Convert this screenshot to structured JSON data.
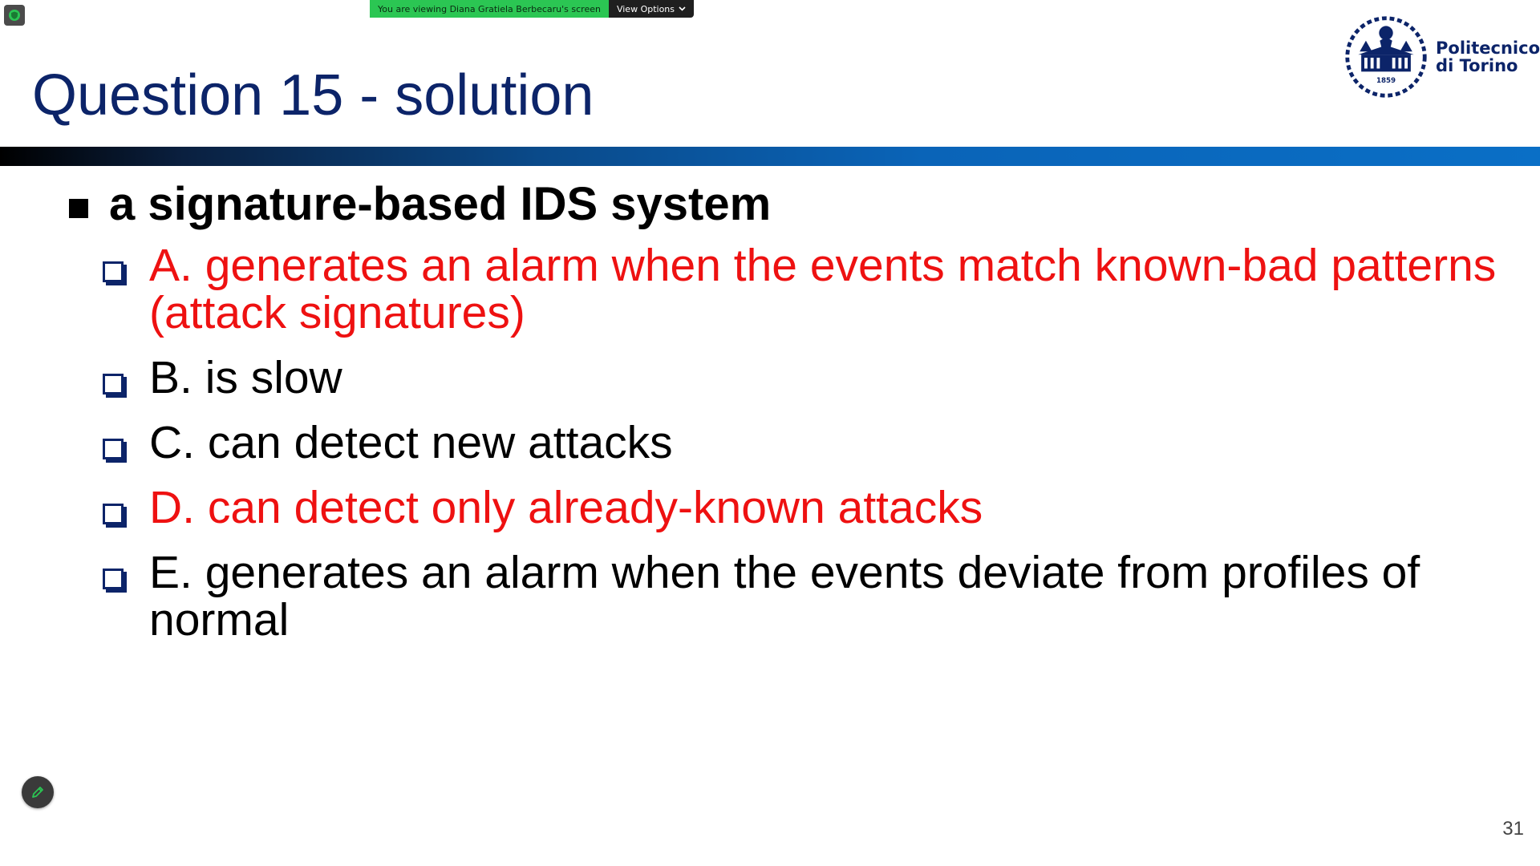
{
  "zoom": {
    "viewing_banner": "You are viewing Diana Gratiela Berbecaru's screen",
    "view_options_label": "View Options"
  },
  "slide": {
    "title": "Question 15 - solution",
    "question": "a signature-based IDS system",
    "options": [
      {
        "text": "A. generates an alarm when the events match known-bad patterns (attack signatures)",
        "correct": true
      },
      {
        "text": "B. is slow",
        "correct": false
      },
      {
        "text": "C. can detect new attacks",
        "correct": false
      },
      {
        "text": "D. can detect only already-known attacks",
        "correct": true
      },
      {
        "text": "E. generates an alarm when the events deviate from profiles of normal",
        "correct": false
      }
    ],
    "page_number": "31"
  },
  "logo": {
    "line1": "Politecnico",
    "line2": "di Torino",
    "year": "1859"
  },
  "colors": {
    "title": "#0c2469",
    "correct": "#ee1111",
    "banner_green": "#2bc653"
  }
}
